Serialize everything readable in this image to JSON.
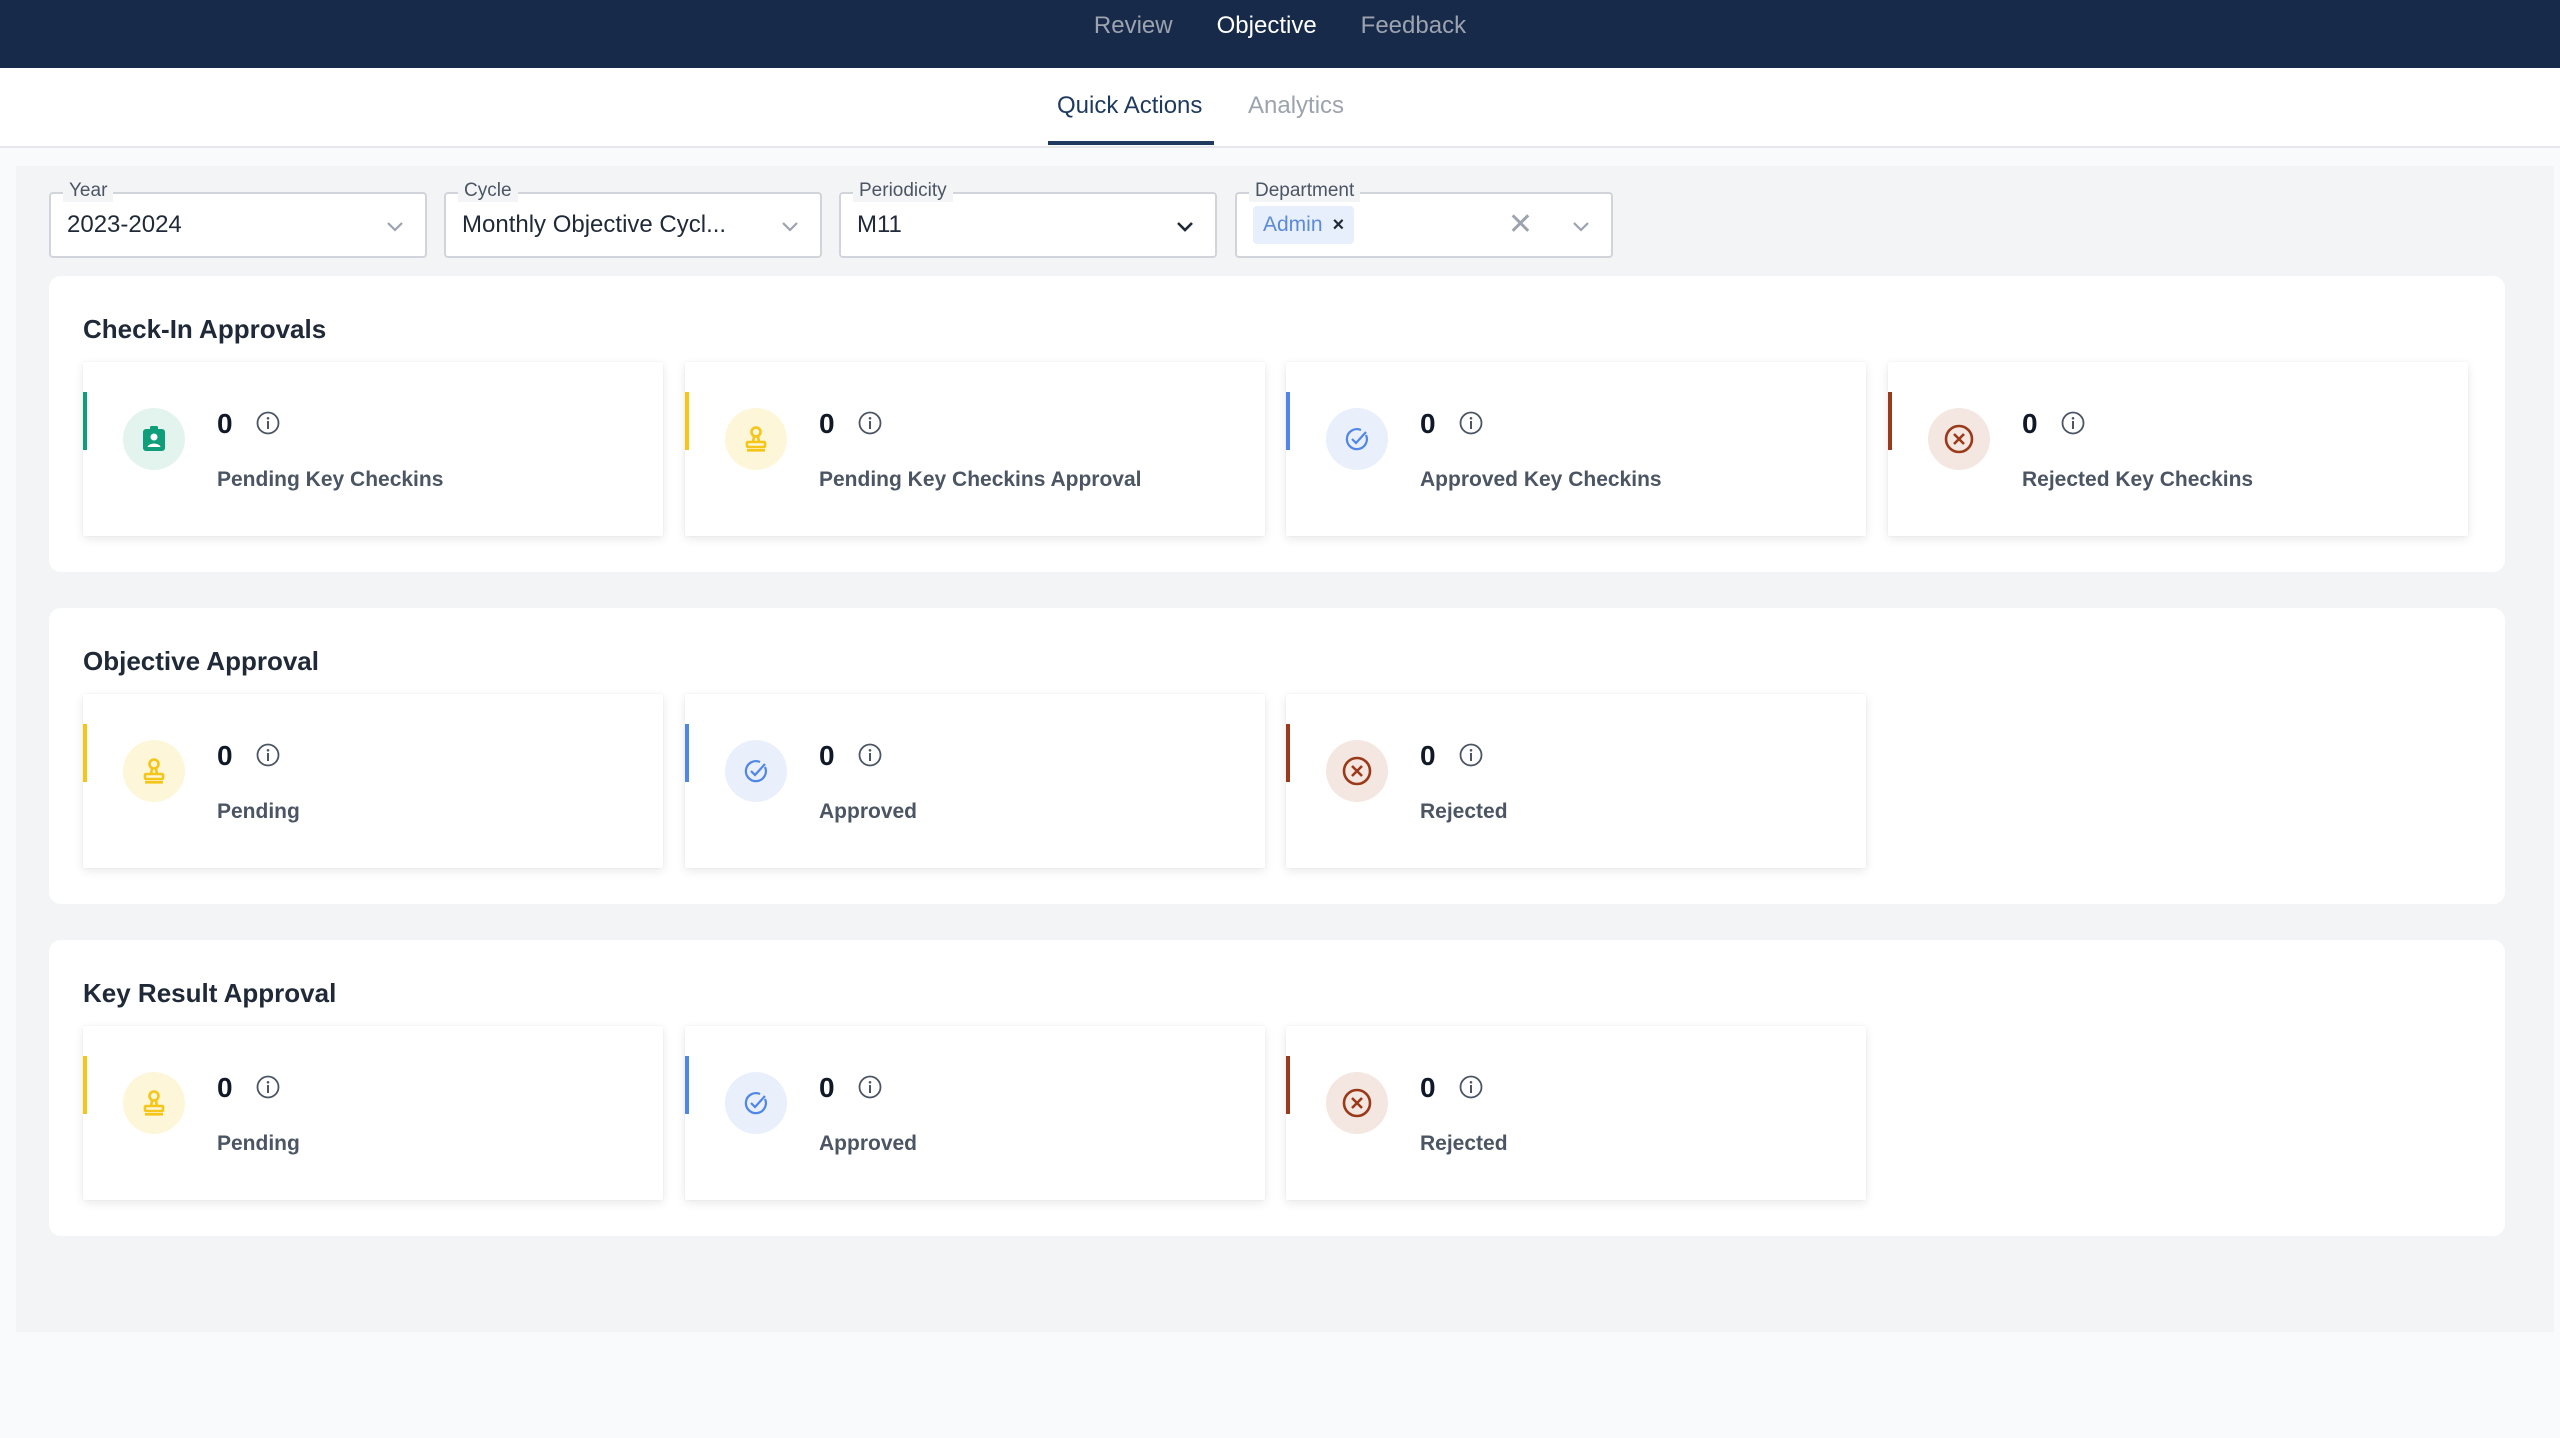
{
  "topnav": {
    "tabs": [
      {
        "label": "Review"
      },
      {
        "label": "Objective"
      },
      {
        "label": "Feedback"
      }
    ]
  },
  "subnav": {
    "tabs": [
      {
        "label": "Quick Actions"
      },
      {
        "label": "Analytics"
      }
    ]
  },
  "filters": {
    "year": {
      "label": "Year",
      "value": "2023-2024"
    },
    "cycle": {
      "label": "Cycle",
      "value": "Monthly Objective Cycl..."
    },
    "periodicity": {
      "label": "Periodicity",
      "value": "M11"
    },
    "department": {
      "label": "Department",
      "chip": "Admin",
      "chip_remove": "×",
      "clear": "✕"
    }
  },
  "colors": {
    "navy": "#172a4a",
    "green": "#0f9d7a",
    "yellow": "#f5c518",
    "blue": "#4f86e8",
    "brown": "#9a3a1a"
  },
  "sections": [
    {
      "title": "Check-In Approvals",
      "cards": [
        {
          "count": "0",
          "label": "Pending Key Checkins",
          "icon": "id-badge-icon"
        },
        {
          "count": "0",
          "label": "Pending Key Checkins Approval",
          "icon": "stamp-icon"
        },
        {
          "count": "0",
          "label": "Approved Key Checkins",
          "icon": "check-circle-icon"
        },
        {
          "count": "0",
          "label": "Rejected Key Checkins",
          "icon": "x-circle-icon"
        }
      ]
    },
    {
      "title": "Objective Approval",
      "cards": [
        {
          "count": "0",
          "label": "Pending",
          "icon": "stamp-icon"
        },
        {
          "count": "0",
          "label": "Approved",
          "icon": "check-circle-icon"
        },
        {
          "count": "0",
          "label": "Rejected",
          "icon": "x-circle-icon"
        }
      ]
    },
    {
      "title": "Key Result Approval",
      "cards": [
        {
          "count": "0",
          "label": "Pending",
          "icon": "stamp-icon"
        },
        {
          "count": "0",
          "label": "Approved",
          "icon": "check-circle-icon"
        },
        {
          "count": "0",
          "label": "Rejected",
          "icon": "x-circle-icon"
        }
      ]
    }
  ]
}
